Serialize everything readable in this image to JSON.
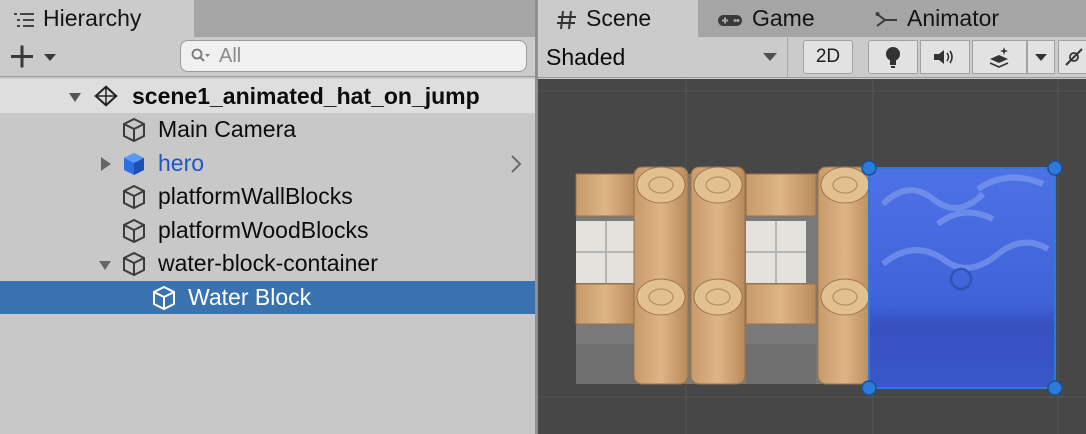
{
  "hierarchy": {
    "tab_label": "Hierarchy",
    "search_placeholder": "All",
    "scene_name": "scene1_animated_hat_on_jump",
    "items": [
      {
        "label": "Main Camera"
      },
      {
        "label": "hero"
      },
      {
        "label": "platformWallBlocks"
      },
      {
        "label": "platformWoodBlocks"
      },
      {
        "label": "water-block-container"
      },
      {
        "label": "Water Block"
      }
    ]
  },
  "scene_view": {
    "tabs": [
      {
        "label": "Scene"
      },
      {
        "label": "Game"
      },
      {
        "label": "Animator"
      }
    ],
    "shading_mode": "Shaded",
    "mode_2d_label": "2D"
  },
  "colors": {
    "selection": "#3a72b0",
    "prefab_blue": "#1f55c9",
    "water": "#3a5fd8",
    "handle": "#2d7bd9"
  }
}
